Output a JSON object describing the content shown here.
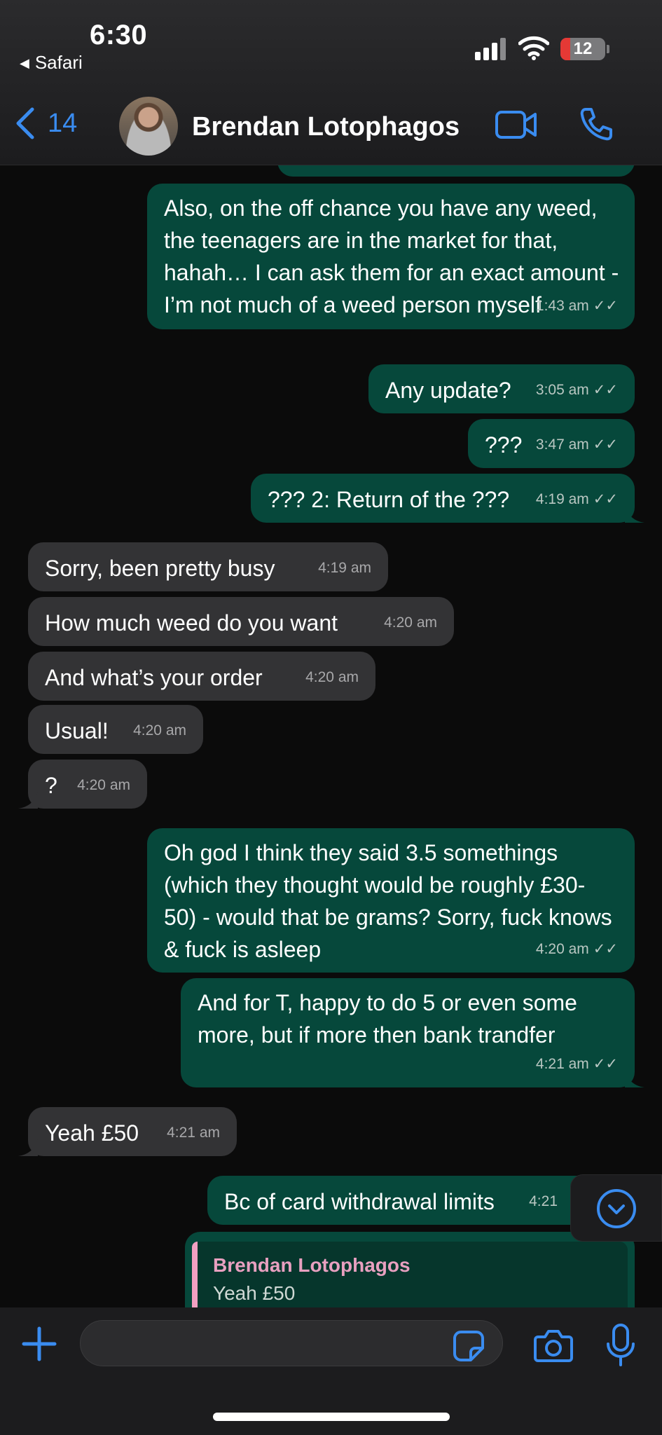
{
  "status_bar": {
    "time": "6:30",
    "back_app": "Safari",
    "battery": "12"
  },
  "header": {
    "back_count": "14",
    "contact_name": "Brendan Lotophagos"
  },
  "messages": [
    {
      "dir": "out",
      "text": "Also, on the off chance you have any weed, the teenagers are in the market for that, hahah… I can ask them for an exact amount - I’m not much of a weed person myself",
      "time": "1:43 am"
    },
    {
      "dir": "out",
      "text": "Any update?",
      "time": "3:05 am"
    },
    {
      "dir": "out",
      "text": "???",
      "time": "3:47 am"
    },
    {
      "dir": "out",
      "text": "??? 2: Return of the ???",
      "time": "4:19 am"
    },
    {
      "dir": "in",
      "text": "Sorry, been pretty busy",
      "time": "4:19 am"
    },
    {
      "dir": "in",
      "text": "How much weed do you want",
      "time": "4:20 am"
    },
    {
      "dir": "in",
      "text": "And what’s your order",
      "time": "4:20 am"
    },
    {
      "dir": "in",
      "text": "Usual!",
      "time": "4:20 am"
    },
    {
      "dir": "in",
      "text": "?",
      "time": "4:20 am"
    },
    {
      "dir": "out",
      "text": "Oh god I think they said 3.5 somethings (which they thought would be roughly £30-50) - would that be grams? Sorry, fuck knows & fuck is asleep",
      "time": "4:20 am"
    },
    {
      "dir": "out",
      "text": "And for T, happy to do 5 or even some more, but if more then bank trandfer",
      "time": "4:21 am"
    },
    {
      "dir": "in",
      "text": "Yeah £50",
      "time": "4:21 am"
    },
    {
      "dir": "out",
      "text": "Bc of card withdrawal limits",
      "time": "4:21"
    }
  ],
  "reply_preview": {
    "name": "Brendan Lotophagos",
    "text": "Yeah £50"
  },
  "colors": {
    "outgoing": "#06483b",
    "incoming": "#333335",
    "accent": "#3a8cf0"
  }
}
